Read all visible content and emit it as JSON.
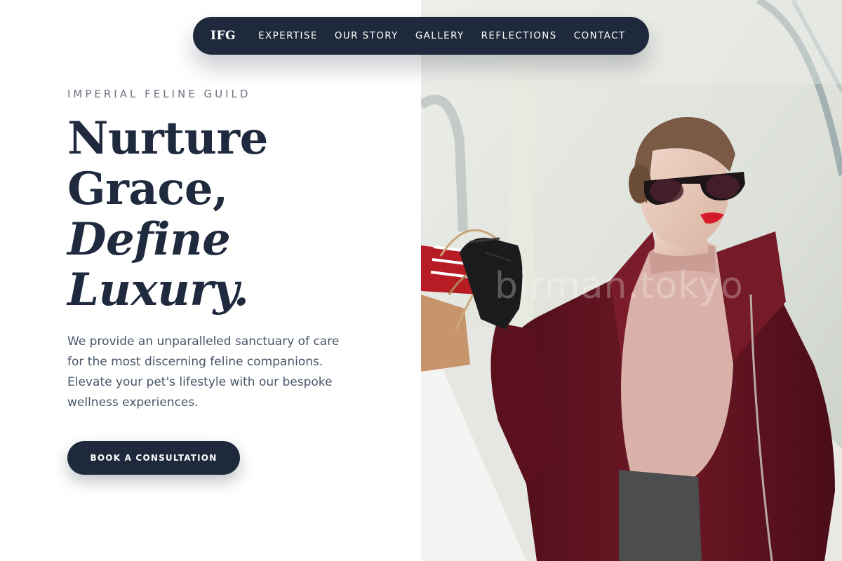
{
  "nav": {
    "brand": "IFG",
    "links": [
      "EXPERTISE",
      "OUR STORY",
      "GALLERY",
      "REFLECTIONS",
      "CONTACT"
    ]
  },
  "hero": {
    "eyebrow": "IMPERIAL FELINE GUILD",
    "headline_lines": [
      "Nurture",
      "Grace,",
      "Define",
      "Luxury."
    ],
    "description": "We provide an unparalleled sanctuary of care for the most discerning feline companions. Elevate your pet's lifestyle with our bespoke wellness experiences.",
    "cta_label": "BOOK A CONSULTATION"
  },
  "photo": {
    "watermark": "birman.tokyo"
  },
  "colors": {
    "navy": "#1e293b",
    "heading": "#1f2a3e",
    "body_text": "#475569",
    "eyebrow": "#6b7280",
    "coat": "#6b1522",
    "background": "#ffffff"
  }
}
